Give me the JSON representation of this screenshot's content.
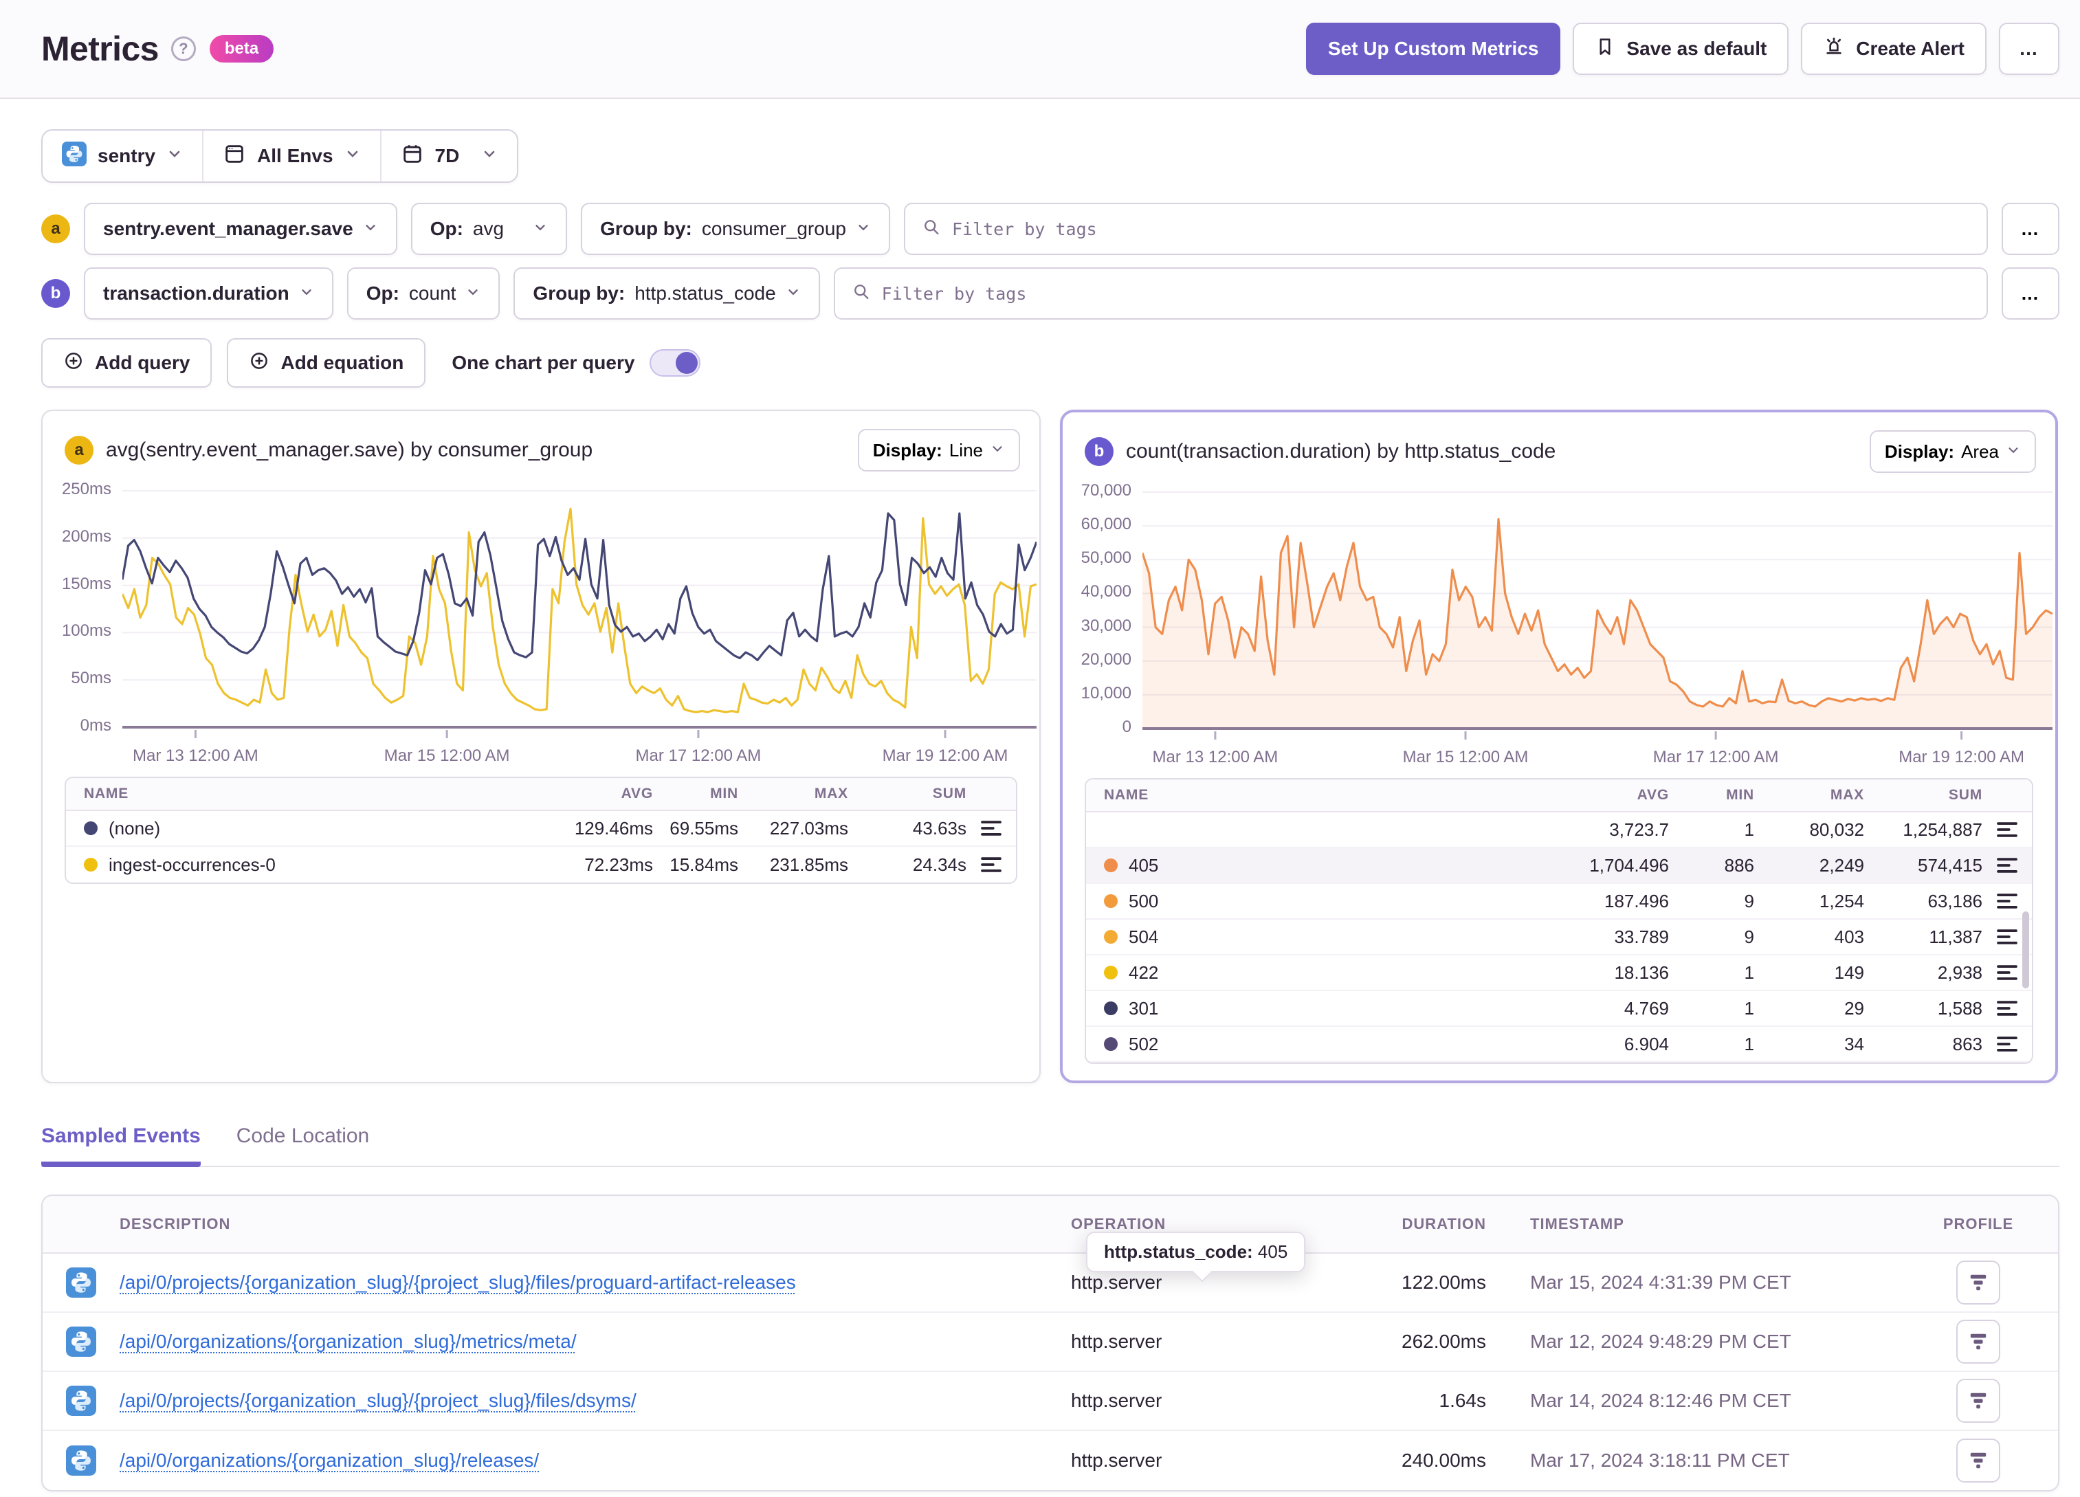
{
  "header": {
    "title": "Metrics",
    "beta_badge": "beta",
    "setup_button": "Set Up Custom Metrics",
    "save_default_button": "Save as default",
    "create_alert_button": "Create Alert",
    "more_button": "…"
  },
  "scope_bar": {
    "project": "sentry",
    "environment": "All Envs",
    "period": "7D"
  },
  "queries": [
    {
      "id": "a",
      "metric": "sentry.event_manager.save",
      "op_label": "Op:",
      "op": "avg",
      "group_label": "Group by:",
      "group": "consumer_group",
      "filter_placeholder": "Filter by tags",
      "more": "…"
    },
    {
      "id": "b",
      "metric": "transaction.duration",
      "op_label": "Op:",
      "op": "count",
      "group_label": "Group by:",
      "group": "http.status_code",
      "filter_placeholder": "Filter by tags",
      "more": "…"
    }
  ],
  "actions": {
    "add_query": "Add query",
    "add_equation": "Add equation",
    "one_chart_toggle": "One chart per query",
    "toggle_on": true
  },
  "tooltip": {
    "label": "http.status_code:",
    "value": "405"
  },
  "tabs": [
    {
      "label": "Sampled Events",
      "active": true
    },
    {
      "label": "Code Location",
      "active": false
    }
  ],
  "events_table": {
    "columns": {
      "description": "DESCRIPTION",
      "operation": "OPERATION",
      "duration": "DURATION",
      "timestamp": "TIMESTAMP",
      "profile": "PROFILE"
    },
    "rows": [
      {
        "description": "/api/0/projects/{organization_slug}/{project_slug}/files/proguard-artifact-releases",
        "operation": "http.server",
        "duration": "122.00ms",
        "timestamp": "Mar 15, 2024 4:31:39 PM CET"
      },
      {
        "description": "/api/0/organizations/{organization_slug}/metrics/meta/",
        "operation": "http.server",
        "duration": "262.00ms",
        "timestamp": "Mar 12, 2024 9:48:29 PM CET"
      },
      {
        "description": "/api/0/projects/{organization_slug}/{project_slug}/files/dsyms/",
        "operation": "http.server",
        "duration": "1.64s",
        "timestamp": "Mar 14, 2024 8:12:46 PM CET"
      },
      {
        "description": "/api/0/organizations/{organization_slug}/releases/",
        "operation": "http.server",
        "duration": "240.00ms",
        "timestamp": "Mar 17, 2024 3:18:11 PM CET"
      }
    ]
  },
  "chart_data": [
    {
      "type": "line",
      "badge": "a",
      "title": "avg(sentry.event_manager.save) by consumer_group",
      "display_label": "Display:",
      "display_value": "Line",
      "ylim": [
        0,
        250
      ],
      "y_ticks": [
        "0ms",
        "50ms",
        "100ms",
        "150ms",
        "200ms",
        "250ms"
      ],
      "x_ticks": [
        "Mar 13 12:00 AM",
        "Mar 15 12:00 AM",
        "Mar 17 12:00 AM",
        "Mar 19 12:00 AM"
      ],
      "x_tick_fractions": [
        0.08,
        0.355,
        0.63,
        0.9
      ],
      "series": [
        {
          "name": "ingest-occurrences-0",
          "color": "#eec22e",
          "values": [
            141,
            126,
            146,
            116,
            129,
            179,
            173,
            161,
            151,
            116,
            109,
            126,
            119,
            99,
            73,
            66,
            46,
            36,
            31,
            29,
            26,
            23,
            29,
            26,
            61,
            36,
            29,
            31,
            106,
            161,
            129,
            101,
            119,
            96,
            103,
            123,
            86,
            129,
            96,
            89,
            79,
            73,
            46,
            39,
            31,
            26,
            29,
            33,
            96,
            89,
            66,
            96,
            181,
            146,
            131,
            81,
            46,
            39,
            206,
            166,
            149,
            163,
            106,
            66,
            46,
            36,
            29,
            26,
            23,
            19,
            18,
            19,
            146,
            131,
            196,
            231,
            151,
            129,
            119,
            131,
            101,
            126,
            79,
            131,
            86,
            46,
            36,
            43,
            39,
            36,
            41,
            29,
            23,
            33,
            19,
            17,
            16,
            17,
            16,
            18,
            17,
            16,
            17,
            16,
            46,
            31,
            29,
            26,
            25,
            29,
            26,
            31,
            23,
            29,
            61,
            46,
            39,
            63,
            53,
            41,
            36,
            49,
            31,
            76,
            56,
            46,
            43,
            49,
            36,
            29,
            26,
            21,
            106,
            73,
            221,
            151,
            141,
            149,
            139,
            146,
            151,
            129,
            49,
            56,
            46,
            61,
            141,
            153,
            149,
            146,
            151,
            96,
            149,
            151
          ]
        },
        {
          "name": "(none)",
          "color": "#444674",
          "values": [
            156,
            192,
            198,
            186,
            168,
            152,
            179,
            171,
            164,
            176,
            168,
            158,
            136,
            125,
            118,
            106,
            100,
            95,
            88,
            84,
            80,
            78,
            83,
            92,
            106,
            142,
            186,
            170,
            150,
            131,
            173,
            179,
            161,
            166,
            168,
            163,
            155,
            141,
            148,
            138,
            146,
            132,
            147,
            96,
            90,
            85,
            80,
            78,
            76,
            91,
            121,
            166,
            151,
            179,
            183,
            161,
            131,
            128,
            136,
            118,
            196,
            206,
            182,
            148,
            112,
            93,
            79,
            76,
            74,
            79,
            193,
            199,
            181,
            201,
            176,
            161,
            168,
            156,
            199,
            151,
            136,
            198,
            129,
            108,
            101,
            106,
            96,
            99,
            91,
            96,
            103,
            93,
            109,
            99,
            136,
            149,
            121,
            106,
            99,
            103,
            91,
            86,
            81,
            76,
            73,
            79,
            76,
            71,
            79,
            86,
            81,
            76,
            113,
            121,
            96,
            103,
            96,
            91,
            146,
            181,
            96,
            99,
            101,
            96,
            106,
            131,
            116,
            153,
            166,
            226,
            219,
            151,
            129,
            179,
            173,
            163,
            169,
            159,
            179,
            163,
            156,
            226,
            136,
            153,
            129,
            119,
            101,
            96,
            109,
            99,
            103,
            193,
            166,
            179,
            196
          ]
        }
      ],
      "legend": {
        "columns": [
          "NAME",
          "AVG",
          "MIN",
          "MAX",
          "SUM"
        ],
        "rows": [
          {
            "name": "(none)",
            "color": "#444674",
            "avg": "129.46ms",
            "min": "69.55ms",
            "max": "227.03ms",
            "sum": "43.63s",
            "highlighted": false
          },
          {
            "name": "ingest-occurrences-0",
            "color": "#efc00d",
            "avg": "72.23ms",
            "min": "15.84ms",
            "max": "231.85ms",
            "sum": "24.34s",
            "highlighted": false
          }
        ]
      }
    },
    {
      "type": "area",
      "badge": "b",
      "title": "count(transaction.duration) by http.status_code",
      "display_label": "Display:",
      "display_value": "Area",
      "ylim": [
        0,
        70000
      ],
      "y_ticks": [
        "0",
        "10,000",
        "20,000",
        "30,000",
        "40,000",
        "50,000",
        "60,000",
        "70,000"
      ],
      "x_ticks": [
        "Mar 13 12:00 AM",
        "Mar 15 12:00 AM",
        "Mar 17 12:00 AM",
        "Mar 19 12:00 AM"
      ],
      "x_tick_fractions": [
        0.08,
        0.355,
        0.63,
        0.9
      ],
      "series": [
        {
          "name": "405",
          "color": "#ef8d4d",
          "fill": "rgba(239,141,77,0.12)",
          "values": [
            52000,
            46000,
            30000,
            28000,
            38000,
            42000,
            35000,
            50000,
            47000,
            38000,
            22000,
            37000,
            39000,
            32000,
            21000,
            30000,
            28000,
            23000,
            45000,
            26000,
            16000,
            52000,
            57000,
            30000,
            55000,
            43000,
            30000,
            36000,
            42000,
            46000,
            38000,
            48000,
            55000,
            42000,
            38000,
            39000,
            30000,
            28000,
            24000,
            33000,
            17000,
            26000,
            32000,
            16000,
            22000,
            20000,
            25000,
            47000,
            38000,
            42000,
            39000,
            30000,
            33000,
            29000,
            62000,
            40000,
            33000,
            28000,
            34000,
            29000,
            35000,
            25000,
            21000,
            17000,
            19000,
            16000,
            18000,
            15000,
            17000,
            35000,
            31000,
            28000,
            33000,
            25000,
            38000,
            35000,
            30000,
            25000,
            23000,
            21000,
            14000,
            13000,
            11000,
            8000,
            7000,
            6500,
            8000,
            7000,
            6500,
            9000,
            7500,
            17000,
            8000,
            8500,
            7500,
            8000,
            7800,
            14500,
            8200,
            7500,
            8000,
            7000,
            6500,
            8000,
            9000,
            8500,
            8000,
            8800,
            8300,
            9000,
            8500,
            8800,
            8200,
            9000,
            8500,
            18000,
            21000,
            14000,
            25000,
            38000,
            28000,
            31000,
            33000,
            30000,
            34000,
            33000,
            26000,
            22000,
            25000,
            19000,
            23000,
            15000,
            14500,
            52000,
            28000,
            30000,
            33000,
            35000,
            34000
          ]
        }
      ],
      "legend": {
        "columns": [
          "NAME",
          "AVG",
          "MIN",
          "MAX",
          "SUM"
        ],
        "rows": [
          {
            "name": "",
            "color": "",
            "avg": "3,723.7",
            "min": "1",
            "max": "80,032",
            "sum": "1,254,887",
            "highlighted": false
          },
          {
            "name": "405",
            "color": "#ef8d4d",
            "avg": "1,704.496",
            "min": "886",
            "max": "2,249",
            "sum": "574,415",
            "highlighted": true
          },
          {
            "name": "500",
            "color": "#f19b3c",
            "avg": "187.496",
            "min": "9",
            "max": "1,254",
            "sum": "63,186",
            "highlighted": false
          },
          {
            "name": "504",
            "color": "#f3ab33",
            "avg": "33.789",
            "min": "9",
            "max": "403",
            "sum": "11,387",
            "highlighted": false
          },
          {
            "name": "422",
            "color": "#efc00d",
            "avg": "18.136",
            "min": "1",
            "max": "149",
            "sum": "2,938",
            "highlighted": false
          },
          {
            "name": "301",
            "color": "#3b3c63",
            "avg": "4.769",
            "min": "1",
            "max": "29",
            "sum": "1,588",
            "highlighted": false
          },
          {
            "name": "502",
            "color": "#554a76",
            "avg": "6.904",
            "min": "1",
            "max": "34",
            "sum": "863",
            "highlighted": false
          }
        ]
      }
    }
  ]
}
